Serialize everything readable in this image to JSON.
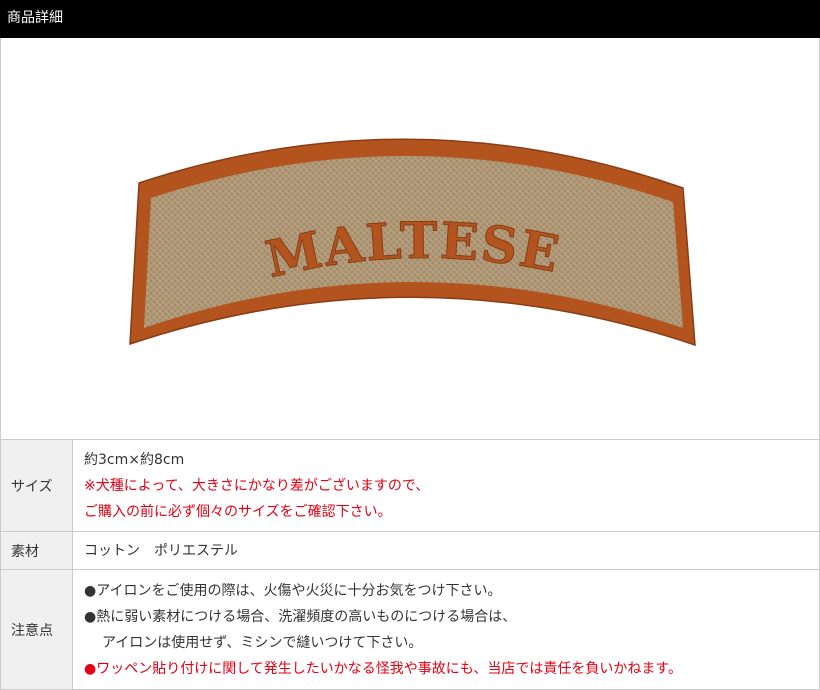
{
  "header": {
    "title": "商品詳細"
  },
  "product_image": {
    "patch_text": "MALTESE"
  },
  "spec_table": {
    "size": {
      "label": "サイズ",
      "value": "約3cm×約8cm",
      "note_line1": "※犬種によって、大きさにかなり差がございますので、",
      "note_line2": "ご購入の前に必ず個々のサイズをご確認下さい。"
    },
    "material": {
      "label": "素材",
      "value": "コットン　ポリエステル"
    },
    "caution": {
      "label": "注意点",
      "line1": "●アイロンをご使用の際は、火傷や火災に十分お気をつけ下さい。",
      "line2": "●熱に弱い素材につける場合、洗濯頻度の高いものにつける場合は、",
      "line3": "アイロンは使用せず、ミシンで縫いつけて下さい。",
      "line4": "●ワッペン貼り付けに関して発生したいかなる怪我や事故にも、当店では責任を負いかねます。"
    }
  },
  "colors": {
    "header_bg": "#000000",
    "patch_border": "#b3541e",
    "patch_fill": "#b09a7a",
    "warning_text": "#e60012"
  }
}
